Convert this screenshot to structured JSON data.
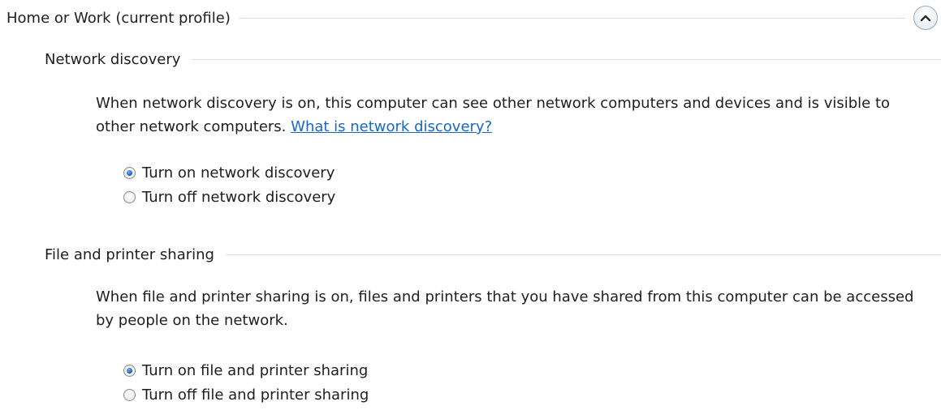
{
  "profile": {
    "title": "Home or Work (current profile)",
    "collapse_icon": "chevron-up-icon"
  },
  "network_discovery": {
    "title": "Network discovery",
    "description": "When network discovery is on, this computer can see other network computers and devices and is visible to other network computers.",
    "link": "What is network discovery?",
    "options": [
      {
        "label": "Turn on network discovery",
        "checked": true
      },
      {
        "label": "Turn off network discovery",
        "checked": false
      }
    ]
  },
  "file_printer_sharing": {
    "title": "File and printer sharing",
    "description": "When file and printer sharing is on, files and printers that you have shared from this computer can be accessed by people on the network.",
    "options": [
      {
        "label": "Turn on file and printer sharing",
        "checked": true
      },
      {
        "label": "Turn off file and printer sharing",
        "checked": false
      }
    ]
  },
  "colors": {
    "link": "#1a66c9",
    "rule": "#d5dfe5",
    "radio_selected": "#1a63b8"
  }
}
